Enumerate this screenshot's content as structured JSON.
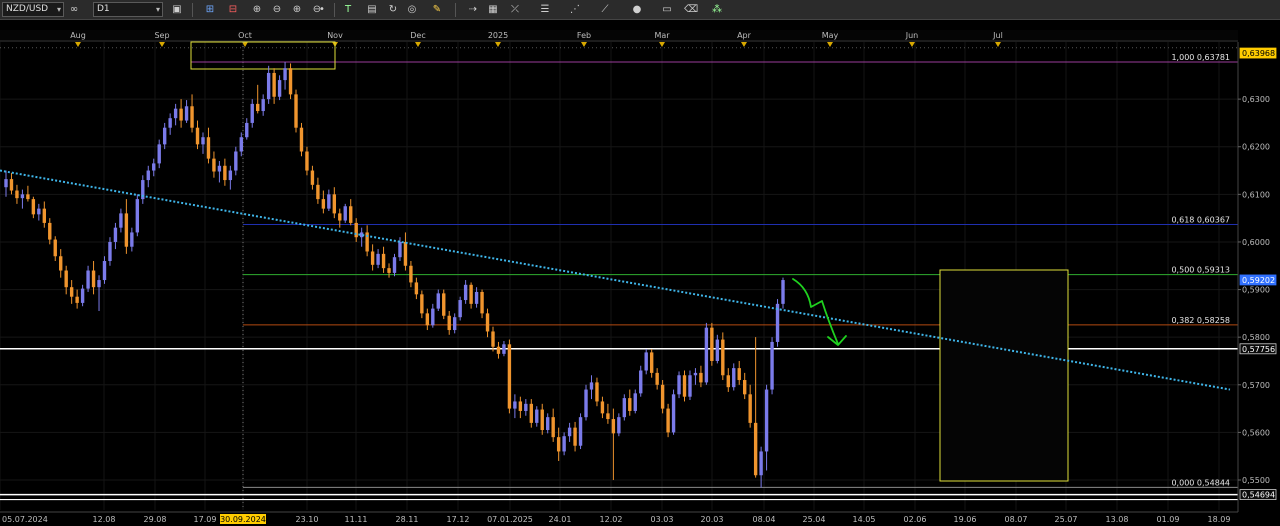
{
  "toolbar": {
    "symbol": "NZD/USD",
    "timeframe": "D1",
    "icons": [
      "link-icon",
      "chart-type-icon",
      "cursor-icon",
      "trendline-icon",
      "zoom-in-icon",
      "zoom-out-icon",
      "zoom-in-icon",
      "zoom-out-icon",
      "point-icon",
      "text-tool-icon",
      "template-icon",
      "refresh-icon",
      "globe-icon",
      "pencil-icon",
      "arrow-tool-icon",
      "grid-icon",
      "indicator-icon",
      "channel-icon",
      "fibonacci-icon",
      "cycle-icon",
      "circle-icon",
      "rectangle-icon",
      "eraser-icon",
      "settings-icon"
    ]
  },
  "colors": {
    "bull": "#7b7bea",
    "bear": "#f0952e",
    "trendline": "#3fb6ea",
    "fib_1000": "#9a3d9a",
    "fib_618": "#1f2fb0",
    "fib_500": "#2fae2f",
    "fib_382": "#b34a10",
    "support": "#ffffff",
    "box": "#e0e03a",
    "arrow": "#1fd11f",
    "current_price_tag": "#3070ff",
    "yellow_tag": "#ffcc00"
  },
  "chart_data": {
    "type": "candlestick",
    "symbol": "NZD/USD",
    "timeframe": "D1",
    "ylim": [
      0.5437,
      0.642
    ],
    "x": [
      "05.07.2024",
      "12.08",
      "29.08",
      "17.09",
      "30.09.2024",
      "23.10",
      "11.11",
      "28.11",
      "17.12",
      "07.01.2025",
      "24.01",
      "12.02",
      "03.03",
      "20.03",
      "08.04",
      "25.04",
      "14.05",
      "02.06",
      "19.06",
      "08.07",
      "25.07",
      "13.08",
      "01.09",
      "18.09"
    ],
    "month_labels": [
      "Aug",
      "Sep",
      "Oct",
      "Nov",
      "Dec",
      "2025",
      "Feb",
      "Mar",
      "Apr",
      "May",
      "Jun",
      "Jul"
    ],
    "y_ticks": [
      "0,6300",
      "0,6200",
      "0,6100",
      "0,6000",
      "0,5900",
      "0,5800",
      "0,5700",
      "0,5600",
      "0,5500"
    ],
    "highlighted_date": "30.09.2024",
    "fibonacci": [
      {
        "label": "1,000 0,63781",
        "value": 0.63781
      },
      {
        "label": "0,618 0,60367",
        "value": 0.60367
      },
      {
        "label": "0,500 0,59313",
        "value": 0.59313
      },
      {
        "label": "0,382 0,58258",
        "value": 0.58258
      },
      {
        "label": "0,000 0,54844",
        "value": 0.54844
      }
    ],
    "price_tags": [
      {
        "label": "0,63968",
        "value": 0.63968,
        "style": "yellow"
      },
      {
        "label": "0,59202",
        "value": 0.59202,
        "style": "current"
      },
      {
        "label": "0,57756",
        "value": 0.57756,
        "style": "dark"
      },
      {
        "label": "0,54694",
        "value": 0.54694,
        "style": "dark"
      }
    ],
    "support_lines": [
      0.57756,
      0.54694
    ],
    "trendline": {
      "from": {
        "date": "05.07.2024",
        "value": 0.615
      },
      "to": {
        "date": "18.09",
        "value": 0.569
      }
    },
    "candles": [
      [
        0.6115,
        0.615,
        0.6095,
        0.6132
      ],
      [
        0.6132,
        0.6145,
        0.61,
        0.6108
      ],
      [
        0.6108,
        0.612,
        0.608,
        0.6092
      ],
      [
        0.6092,
        0.611,
        0.607,
        0.61
      ],
      [
        0.61,
        0.6118,
        0.6085,
        0.609
      ],
      [
        0.609,
        0.6095,
        0.605,
        0.6058
      ],
      [
        0.6058,
        0.608,
        0.6045,
        0.607
      ],
      [
        0.607,
        0.6085,
        0.603,
        0.604
      ],
      [
        0.604,
        0.605,
        0.5995,
        0.6005
      ],
      [
        0.6005,
        0.6012,
        0.596,
        0.597
      ],
      [
        0.597,
        0.5985,
        0.5925,
        0.594
      ],
      [
        0.594,
        0.595,
        0.589,
        0.5905
      ],
      [
        0.5905,
        0.592,
        0.587,
        0.5885
      ],
      [
        0.5885,
        0.59,
        0.586,
        0.5872
      ],
      [
        0.5872,
        0.591,
        0.5865,
        0.5902
      ],
      [
        0.5902,
        0.595,
        0.5895,
        0.594
      ],
      [
        0.594,
        0.596,
        0.589,
        0.5905
      ],
      [
        0.5905,
        0.593,
        0.5855,
        0.592
      ],
      [
        0.592,
        0.597,
        0.5912,
        0.596
      ],
      [
        0.596,
        0.601,
        0.595,
        0.6
      ],
      [
        0.6,
        0.604,
        0.5985,
        0.603
      ],
      [
        0.603,
        0.607,
        0.602,
        0.606
      ],
      [
        0.606,
        0.609,
        0.5975,
        0.599
      ],
      [
        0.599,
        0.603,
        0.598,
        0.602
      ],
      [
        0.602,
        0.61,
        0.6012,
        0.609
      ],
      [
        0.609,
        0.614,
        0.608,
        0.613
      ],
      [
        0.613,
        0.616,
        0.6115,
        0.615
      ],
      [
        0.615,
        0.6175,
        0.6138,
        0.6165
      ],
      [
        0.6165,
        0.6215,
        0.6155,
        0.6205
      ],
      [
        0.6205,
        0.625,
        0.6195,
        0.624
      ],
      [
        0.624,
        0.627,
        0.6225,
        0.626
      ],
      [
        0.626,
        0.629,
        0.6245,
        0.628
      ],
      [
        0.628,
        0.63,
        0.624,
        0.6255
      ],
      [
        0.6255,
        0.6298,
        0.625,
        0.6285
      ],
      [
        0.6285,
        0.631,
        0.623,
        0.624
      ],
      [
        0.624,
        0.6255,
        0.6195,
        0.6205
      ],
      [
        0.6205,
        0.623,
        0.6185,
        0.622
      ],
      [
        0.622,
        0.624,
        0.6165,
        0.6175
      ],
      [
        0.6175,
        0.619,
        0.6135,
        0.6148
      ],
      [
        0.6148,
        0.617,
        0.6125,
        0.616
      ],
      [
        0.616,
        0.6175,
        0.6118,
        0.613
      ],
      [
        0.613,
        0.616,
        0.611,
        0.615
      ],
      [
        0.615,
        0.62,
        0.614,
        0.619
      ],
      [
        0.619,
        0.623,
        0.618,
        0.622
      ],
      [
        0.622,
        0.626,
        0.6215,
        0.625
      ],
      [
        0.625,
        0.63,
        0.624,
        0.629
      ],
      [
        0.629,
        0.633,
        0.627,
        0.6275
      ],
      [
        0.6275,
        0.631,
        0.6265,
        0.63
      ],
      [
        0.63,
        0.637,
        0.629,
        0.6355
      ],
      [
        0.6355,
        0.6365,
        0.629,
        0.6305
      ],
      [
        0.6305,
        0.635,
        0.6298,
        0.634
      ],
      [
        0.634,
        0.6378,
        0.632,
        0.6365
      ],
      [
        0.6365,
        0.6375,
        0.63,
        0.631
      ],
      [
        0.631,
        0.632,
        0.623,
        0.624
      ],
      [
        0.624,
        0.625,
        0.618,
        0.619
      ],
      [
        0.619,
        0.62,
        0.614,
        0.615
      ],
      [
        0.615,
        0.616,
        0.611,
        0.612
      ],
      [
        0.612,
        0.6135,
        0.608,
        0.609
      ],
      [
        0.609,
        0.6108,
        0.606,
        0.607
      ],
      [
        0.607,
        0.611,
        0.6065,
        0.61
      ],
      [
        0.61,
        0.6115,
        0.605,
        0.606
      ],
      [
        0.606,
        0.607,
        0.603,
        0.6045
      ],
      [
        0.6045,
        0.608,
        0.604,
        0.6075
      ],
      [
        0.6075,
        0.609,
        0.6035,
        0.604
      ],
      [
        0.604,
        0.605,
        0.6,
        0.601
      ],
      [
        0.601,
        0.603,
        0.599,
        0.602
      ],
      [
        0.602,
        0.6035,
        0.597,
        0.598
      ],
      [
        0.598,
        0.5995,
        0.594,
        0.5952
      ],
      [
        0.5952,
        0.5985,
        0.5945,
        0.5975
      ],
      [
        0.5975,
        0.599,
        0.5935,
        0.5945
      ],
      [
        0.5945,
        0.5955,
        0.5925,
        0.5935
      ],
      [
        0.5935,
        0.5975,
        0.5928,
        0.5968
      ],
      [
        0.5968,
        0.601,
        0.596,
        0.6
      ],
      [
        0.6,
        0.602,
        0.594,
        0.595
      ],
      [
        0.595,
        0.596,
        0.5905,
        0.5915
      ],
      [
        0.5915,
        0.5925,
        0.588,
        0.589
      ],
      [
        0.589,
        0.5898,
        0.584,
        0.585
      ],
      [
        0.585,
        0.586,
        0.5815,
        0.5825
      ],
      [
        0.5825,
        0.587,
        0.582,
        0.586
      ],
      [
        0.586,
        0.59,
        0.5855,
        0.5892
      ],
      [
        0.5892,
        0.59,
        0.5838,
        0.5845
      ],
      [
        0.5845,
        0.5855,
        0.5805,
        0.5815
      ],
      [
        0.5815,
        0.585,
        0.5808,
        0.5842
      ],
      [
        0.5842,
        0.5885,
        0.5835,
        0.5878
      ],
      [
        0.5878,
        0.592,
        0.587,
        0.591
      ],
      [
        0.591,
        0.5915,
        0.586,
        0.587
      ],
      [
        0.587,
        0.5905,
        0.5862,
        0.5895
      ],
      [
        0.5895,
        0.59,
        0.584,
        0.585
      ],
      [
        0.585,
        0.586,
        0.58,
        0.5812
      ],
      [
        0.5812,
        0.5822,
        0.577,
        0.578
      ],
      [
        0.578,
        0.579,
        0.5755,
        0.5765
      ],
      [
        0.5765,
        0.5792,
        0.576,
        0.5785
      ],
      [
        0.5785,
        0.5795,
        0.564,
        0.565
      ],
      [
        0.565,
        0.568,
        0.563,
        0.5665
      ],
      [
        0.5665,
        0.5675,
        0.563,
        0.5645
      ],
      [
        0.5645,
        0.567,
        0.5635,
        0.566
      ],
      [
        0.566,
        0.567,
        0.561,
        0.562
      ],
      [
        0.562,
        0.5655,
        0.5612,
        0.5648
      ],
      [
        0.5648,
        0.566,
        0.5595,
        0.5605
      ],
      [
        0.5605,
        0.564,
        0.5598,
        0.5632
      ],
      [
        0.5632,
        0.565,
        0.558,
        0.559
      ],
      [
        0.559,
        0.561,
        0.554,
        0.556
      ],
      [
        0.556,
        0.56,
        0.5552,
        0.5592
      ],
      [
        0.5592,
        0.562,
        0.558,
        0.561
      ],
      [
        0.561,
        0.5622,
        0.556,
        0.5572
      ],
      [
        0.5572,
        0.564,
        0.5565,
        0.5632
      ],
      [
        0.5632,
        0.57,
        0.5625,
        0.569
      ],
      [
        0.569,
        0.572,
        0.567,
        0.5705
      ],
      [
        0.5705,
        0.5715,
        0.5655,
        0.5665
      ],
      [
        0.5665,
        0.5675,
        0.563,
        0.564
      ],
      [
        0.564,
        0.566,
        0.5618,
        0.5628
      ],
      [
        0.5628,
        0.565,
        0.55,
        0.5598
      ],
      [
        0.5598,
        0.564,
        0.5592,
        0.5632
      ],
      [
        0.5632,
        0.568,
        0.5625,
        0.5672
      ],
      [
        0.5672,
        0.569,
        0.5635,
        0.5645
      ],
      [
        0.5645,
        0.569,
        0.564,
        0.5682
      ],
      [
        0.5682,
        0.574,
        0.5675,
        0.573
      ],
      [
        0.573,
        0.5775,
        0.5722,
        0.5768
      ],
      [
        0.5768,
        0.5775,
        0.5715,
        0.5725
      ],
      [
        0.5725,
        0.5735,
        0.569,
        0.57
      ],
      [
        0.57,
        0.571,
        0.564,
        0.565
      ],
      [
        0.565,
        0.566,
        0.559,
        0.56
      ],
      [
        0.56,
        0.569,
        0.5595,
        0.568
      ],
      [
        0.568,
        0.5728,
        0.5672,
        0.572
      ],
      [
        0.572,
        0.573,
        0.5665,
        0.5675
      ],
      [
        0.5675,
        0.573,
        0.5668,
        0.572
      ],
      [
        0.572,
        0.5735,
        0.57,
        0.5725
      ],
      [
        0.5725,
        0.574,
        0.5695,
        0.5705
      ],
      [
        0.5705,
        0.583,
        0.57,
        0.582
      ],
      [
        0.582,
        0.583,
        0.574,
        0.575
      ],
      [
        0.575,
        0.5805,
        0.5745,
        0.5795
      ],
      [
        0.5795,
        0.581,
        0.571,
        0.572
      ],
      [
        0.572,
        0.5735,
        0.5685,
        0.5695
      ],
      [
        0.5695,
        0.5745,
        0.5688,
        0.5735
      ],
      [
        0.5735,
        0.575,
        0.57,
        0.571
      ],
      [
        0.571,
        0.5725,
        0.567,
        0.568
      ],
      [
        0.568,
        0.57,
        0.561,
        0.562
      ],
      [
        0.562,
        0.58,
        0.5505,
        0.551
      ],
      [
        0.551,
        0.557,
        0.5484,
        0.556
      ],
      [
        0.556,
        0.57,
        0.552,
        0.569
      ],
      [
        0.569,
        0.58,
        0.568,
        0.579
      ],
      [
        0.579,
        0.588,
        0.578,
        0.587
      ],
      [
        0.587,
        0.5925,
        0.586,
        0.592
      ]
    ]
  }
}
